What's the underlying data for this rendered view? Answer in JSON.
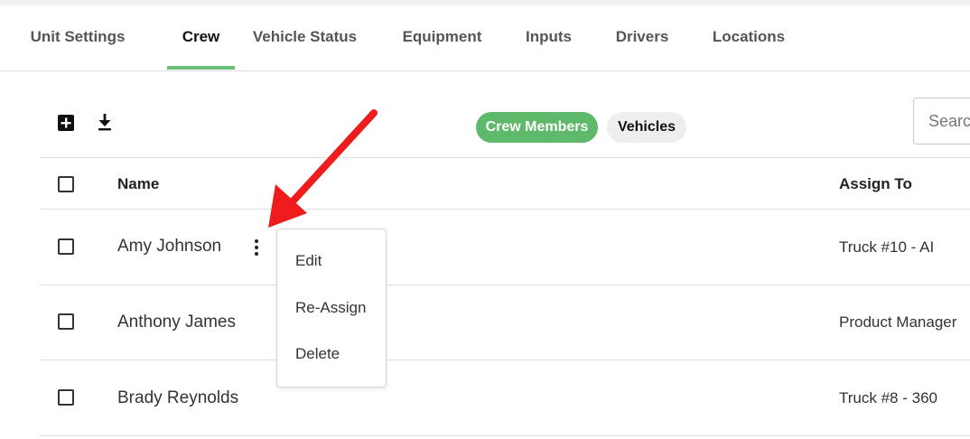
{
  "tabs": [
    {
      "label": "Unit Settings"
    },
    {
      "label": "Crew"
    },
    {
      "label": "Vehicle Status"
    },
    {
      "label": "Equipment"
    },
    {
      "label": "Inputs"
    },
    {
      "label": "Drivers"
    },
    {
      "label": "Locations"
    }
  ],
  "active_tab": "Crew",
  "toolbar": {
    "add_icon": "add-box-icon",
    "download_icon": "download-icon",
    "toggle_active": "Crew Members",
    "toggle_inactive": "Vehicles",
    "search_placeholder": "Search"
  },
  "table": {
    "headers": {
      "name": "Name",
      "assign_to": "Assign To"
    },
    "rows": [
      {
        "name": "Amy Johnson",
        "assign_to": "Truck #10 - AI"
      },
      {
        "name": "Anthony James",
        "assign_to": "Product Manager"
      },
      {
        "name": "Brady Reynolds",
        "assign_to": "Truck #8 - 360"
      }
    ]
  },
  "context_menu": {
    "items": [
      {
        "label": "Edit"
      },
      {
        "label": "Re-Assign"
      },
      {
        "label": "Delete"
      }
    ]
  },
  "colors": {
    "accent_green": "#5fb96a",
    "annotation_red": "#ee1c1c"
  }
}
